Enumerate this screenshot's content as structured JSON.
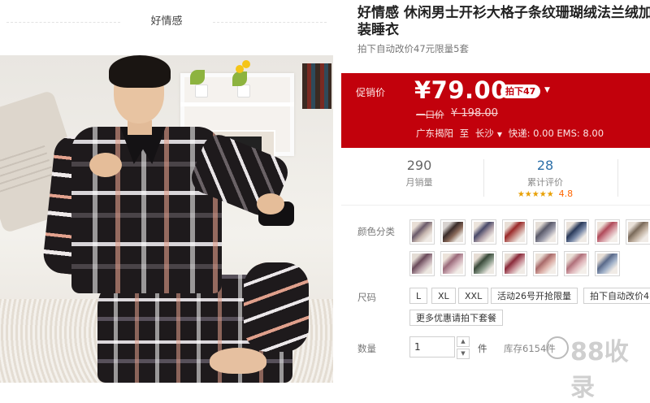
{
  "shop": {
    "name": "好情感"
  },
  "product": {
    "title_line1": "好情感 休闲男士开衫大格子条纹珊瑚绒法兰绒加",
    "title_line2": "装睡衣",
    "subtitle": "拍下自动改价47元限量5套"
  },
  "price_panel": {
    "label": "促销价",
    "price": "¥79.00",
    "coupon": "拍下47",
    "original_label": "一口价",
    "original_price": "¥ 198.00",
    "ship_from": "广东揭阳",
    "ship_to_word": "至",
    "ship_to": "长沙",
    "ship_fees": "快递: 0.00 EMS: 8.00",
    "colors": {
      "background": "#c2010c",
      "text": "#ffffff"
    }
  },
  "stats": {
    "monthly_sales": {
      "value": "290",
      "label": "月销量"
    },
    "reviews": {
      "value": "28",
      "label": "累计评价",
      "rating": "4.8",
      "stars": 5
    },
    "value_color": "#2c6fa8"
  },
  "color_row": {
    "label": "颜色分类",
    "swatch_count": 15
  },
  "size_row": {
    "label": "尺码",
    "options": [
      "L",
      "XL",
      "XXL",
      "活动26号开抢限量",
      "拍下自动改价4"
    ],
    "more_button": "更多优惠请拍下套餐"
  },
  "quantity_row": {
    "label": "数量",
    "value": "1",
    "unit": "件",
    "stock": "库存6154件"
  },
  "watermark": {
    "text": "88收录"
  }
}
